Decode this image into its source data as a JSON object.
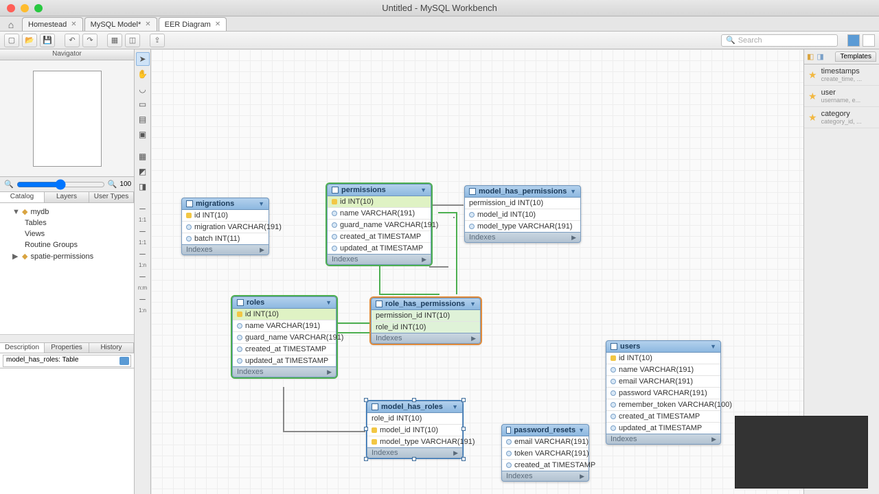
{
  "window": {
    "title": "Untitled - MySQL Workbench"
  },
  "tabs": [
    {
      "label": "Homestead"
    },
    {
      "label": "MySQL Model*"
    },
    {
      "label": "EER Diagram",
      "active": true
    }
  ],
  "toolbar": {
    "search_placeholder": "Search"
  },
  "navigator": {
    "title": "Navigator",
    "zoom": "100",
    "tabs": [
      "Catalog",
      "Layers",
      "User Types"
    ],
    "tree": [
      {
        "label": "mydb",
        "expanded": true,
        "children": [
          "Tables",
          "Views",
          "Routine Groups"
        ]
      },
      {
        "label": "spatie-permissions",
        "expanded": false
      }
    ],
    "prop_tabs": [
      "Description",
      "Properties",
      "History"
    ],
    "selected_item": "model_has_roles: Table"
  },
  "templates": {
    "title": "Templates",
    "items": [
      {
        "name": "timestamps",
        "sub": "create_time, ..."
      },
      {
        "name": "user",
        "sub": "username, e..."
      },
      {
        "name": "category",
        "sub": "category_id, ..."
      }
    ]
  },
  "entities": {
    "migrations": {
      "title": "migrations",
      "rows": [
        {
          "k": true,
          "t": "id INT(10)"
        },
        {
          "t": "migration VARCHAR(191)"
        },
        {
          "t": "batch INT(11)"
        }
      ],
      "indexes": "Indexes"
    },
    "permissions": {
      "title": "permissions",
      "rows": [
        {
          "k": true,
          "t": "id INT(10)"
        },
        {
          "t": "name VARCHAR(191)"
        },
        {
          "t": "guard_name VARCHAR(191)"
        },
        {
          "t": "created_at TIMESTAMP"
        },
        {
          "t": "updated_at TIMESTAMP"
        }
      ],
      "indexes": "Indexes"
    },
    "model_has_permissions": {
      "title": "model_has_permissions",
      "rows": [
        {
          "t": "permission_id INT(10)"
        },
        {
          "t": "model_id INT(10)"
        },
        {
          "t": "model_type VARCHAR(191)"
        }
      ],
      "indexes": "Indexes"
    },
    "roles": {
      "title": "roles",
      "rows": [
        {
          "k": true,
          "t": "id INT(10)"
        },
        {
          "t": "name VARCHAR(191)"
        },
        {
          "t": "guard_name VARCHAR(191)"
        },
        {
          "t": "created_at TIMESTAMP"
        },
        {
          "t": "updated_at TIMESTAMP"
        }
      ],
      "indexes": "Indexes"
    },
    "role_has_permissions": {
      "title": "role_has_permissions",
      "rows": [
        {
          "t": "permission_id INT(10)"
        },
        {
          "t": "role_id INT(10)"
        }
      ],
      "indexes": "Indexes"
    },
    "model_has_roles": {
      "title": "model_has_roles",
      "rows": [
        {
          "t": "role_id INT(10)"
        },
        {
          "k": true,
          "t": "model_id INT(10)"
        },
        {
          "k": true,
          "t": "model_type VARCHAR(191)"
        }
      ],
      "indexes": "Indexes"
    },
    "password_resets": {
      "title": "password_resets",
      "rows": [
        {
          "t": "email VARCHAR(191)"
        },
        {
          "t": "token VARCHAR(191)"
        },
        {
          "t": "created_at TIMESTAMP"
        }
      ],
      "indexes": "Indexes"
    },
    "users": {
      "title": "users",
      "rows": [
        {
          "k": true,
          "t": "id INT(10)"
        },
        {
          "t": "name VARCHAR(191)"
        },
        {
          "t": "email VARCHAR(191)"
        },
        {
          "t": "password VARCHAR(191)"
        },
        {
          "t": "remember_token VARCHAR(100)"
        },
        {
          "t": "created_at TIMESTAMP"
        },
        {
          "t": "updated_at TIMESTAMP"
        }
      ],
      "indexes": "Indexes"
    }
  },
  "tool_labels": {
    "r11a": "1:1",
    "r11b": "1:1",
    "r1n": "1:n",
    "rnm": "n:m",
    "rnn": "1:n"
  }
}
